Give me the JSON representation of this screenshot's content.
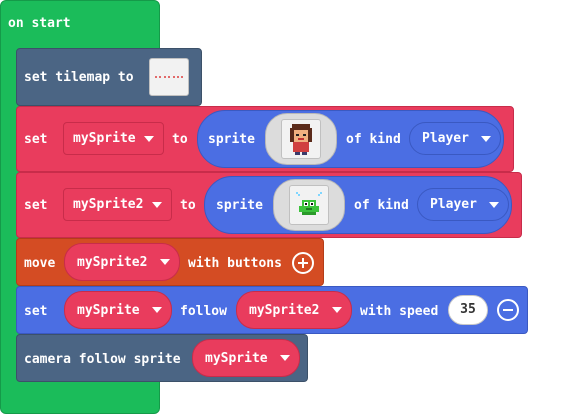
{
  "hat": {
    "label": "on start"
  },
  "tilemap_block": {
    "label": "set tilemap to",
    "thumb_text": "tilemap"
  },
  "set1": {
    "set_label": "set",
    "var": "mySprite",
    "to_label": "to",
    "sprite_label": "sprite",
    "of_kind_label": "of kind",
    "kind": "Player"
  },
  "set2": {
    "set_label": "set",
    "var": "mySprite2",
    "to_label": "to",
    "sprite_label": "sprite",
    "of_kind_label": "of kind",
    "kind": "Player"
  },
  "move_block": {
    "move_label": "move",
    "var": "mySprite2",
    "with_label": "with buttons"
  },
  "follow_block": {
    "set_label": "set",
    "var": "mySprite",
    "follow_label": "follow",
    "target": "mySprite2",
    "speed_label": "with speed",
    "speed": "35"
  },
  "camera_block": {
    "label": "camera follow sprite",
    "var": "mySprite"
  },
  "icons": {
    "dropdown": "chevron-down-icon",
    "add": "plus-circle-icon",
    "remove": "minus-circle-icon"
  },
  "colors": {
    "events": "#1bbc5a",
    "scene": "#4b6584",
    "sprites": "#e93c5d",
    "controller": "#d44c23",
    "physics": "#4b6ee3"
  }
}
